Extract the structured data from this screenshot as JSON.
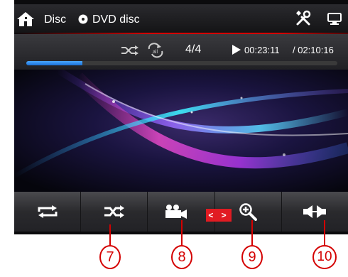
{
  "header": {
    "home_icon": "home-icon",
    "title": "Disc",
    "source_icon": "disc-icon",
    "source_label": "DVD disc",
    "tools_icon": "tools-icon",
    "screen_icon": "display-icon"
  },
  "status": {
    "shuffle_icon": "shuffle-icon",
    "repeat_all_icon": "repeat-all-icon",
    "track": "4/4",
    "play_icon": "play-icon",
    "elapsed": "00:23:11",
    "total": "/ 02:10:16",
    "progress_fraction": 0.18,
    "progress_color": "#2f8cf0"
  },
  "controls": [
    {
      "name": "repeat-button",
      "icon": "repeat-icon"
    },
    {
      "name": "shuffle-button",
      "icon": "shuffle-icon"
    },
    {
      "name": "camera-angle-button",
      "icon": "video-camera-icon"
    },
    {
      "name": "zoom-button",
      "icon": "zoom-icon"
    },
    {
      "name": "audio-channel-button",
      "icon": "speaker-channel-icon"
    }
  ],
  "arrows_label": "< >",
  "callouts": [
    "7",
    "8",
    "9",
    "10"
  ],
  "colors": {
    "accent_red": "#d40000",
    "progress_blue": "#2f8cf0"
  }
}
